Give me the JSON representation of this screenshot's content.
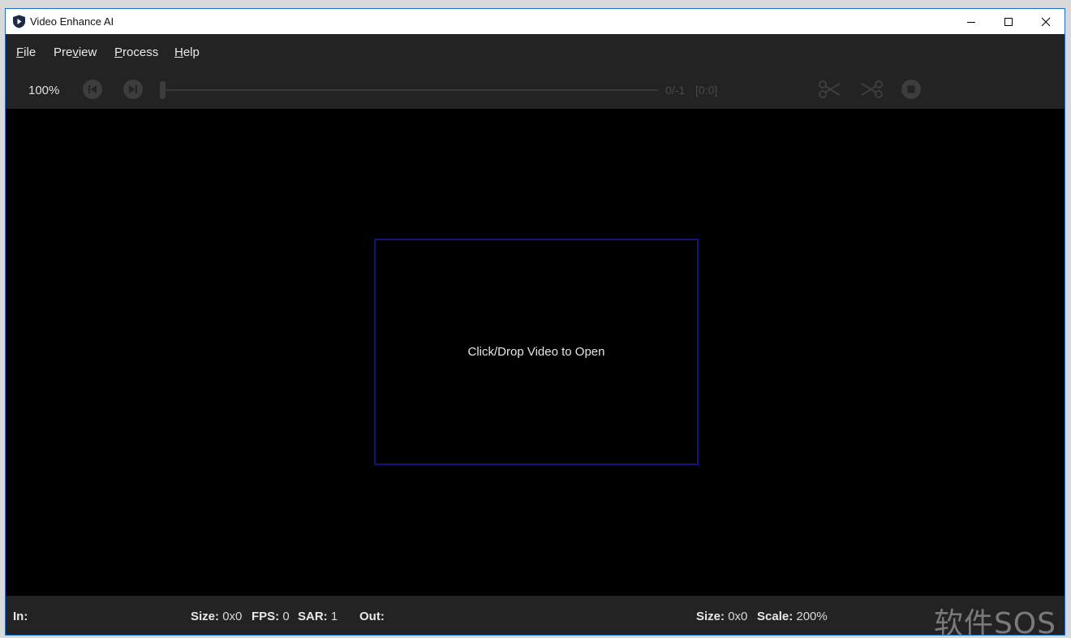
{
  "window": {
    "title": "Video Enhance AI"
  },
  "menu": {
    "file": {
      "mnemonic": "F",
      "rest": "ile"
    },
    "preview": {
      "before": "Pre",
      "mnemonic": "v",
      "after": "iew"
    },
    "process": {
      "mnemonic": "P",
      "rest": "rocess"
    },
    "help": {
      "mnemonic": "H",
      "rest": "elp"
    }
  },
  "toolbar": {
    "zoom": "100%",
    "frame_counter": "0/-1",
    "frame_range": "[0:0]",
    "slider_position": 0
  },
  "canvas": {
    "drop_prompt": "Click/Drop Video to Open"
  },
  "status": {
    "in_label": "In:",
    "in_size_label": "Size:",
    "in_size_value": "0x0",
    "fps_label": "FPS:",
    "fps_value": "0",
    "sar_label": "SAR:",
    "sar_value": "1",
    "out_label": "Out:",
    "out_size_label": "Size:",
    "out_size_value": "0x0",
    "scale_label": "Scale:",
    "scale_value": "200%"
  },
  "watermark": "软件SOS",
  "colors": {
    "accent_border": "#1f6fd0",
    "drop_zone_border": "#14147a",
    "panel_bg": "#232323"
  }
}
